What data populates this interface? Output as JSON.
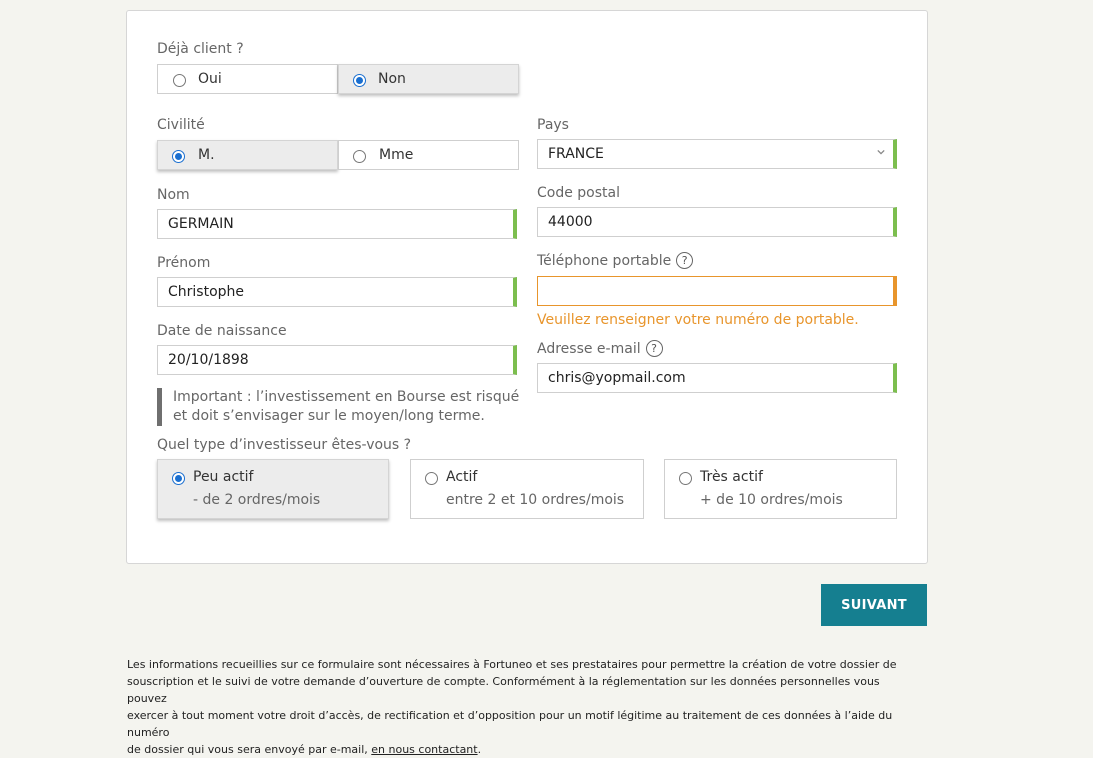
{
  "client": {
    "label": "Déjà client ?",
    "options": [
      "Oui",
      "Non"
    ],
    "selected": "Non"
  },
  "civilite": {
    "label": "Civilité",
    "options": [
      "M.",
      "Mme"
    ],
    "selected": "M."
  },
  "pays": {
    "label": "Pays",
    "value": "FRANCE"
  },
  "nom": {
    "label": "Nom",
    "value": "GERMAIN"
  },
  "code_postal": {
    "label": "Code postal",
    "value": "44000"
  },
  "prenom": {
    "label": "Prénom",
    "value": "Christophe"
  },
  "telephone": {
    "label": "Téléphone portable",
    "value": "",
    "error": "Veuillez renseigner votre numéro de portable."
  },
  "date_naissance": {
    "label": "Date de naissance",
    "value": "20/10/1898"
  },
  "email": {
    "label": "Adresse e-mail",
    "value": "chris@yopmail.com"
  },
  "help_symbol": "?",
  "important_note": {
    "line1": "Important : l’investissement en Bourse est risqué",
    "line2": "et doit s’envisager sur le moyen/long terme."
  },
  "investisseur": {
    "label": "Quel type d’investisseur êtes-vous ?",
    "options": [
      {
        "title": "Peu actif",
        "sub": "- de 2 ordres/mois"
      },
      {
        "title": "Actif",
        "sub": "entre 2 et 10 ordres/mois"
      },
      {
        "title": "Très actif",
        "sub": "+ de 10 ordres/mois"
      }
    ],
    "selected": "Peu actif"
  },
  "suivant_label": "SUIVANT",
  "legal": {
    "line1": "Les informations recueillies sur ce formulaire sont nécessaires à Fortuneo et ses prestataires pour permettre la création de votre dossier de",
    "line2": "souscription et le suivi de votre demande d’ouverture de compte. Conformément à la réglementation sur les données personnelles vous pouvez",
    "line3": "exercer à tout moment votre droit d’accès, de rectification et d’opposition pour un motif légitime au traitement de ces données à l’aide du numéro",
    "line4_prefix": "de dossier qui vous sera envoyé par e-mail, ",
    "link": "en nous contactant",
    "line4_suffix": "."
  },
  "colors": {
    "accent": "#157f90",
    "valid": "#7cbe4e",
    "error": "#e8952c",
    "radio": "#1a6fd0"
  }
}
